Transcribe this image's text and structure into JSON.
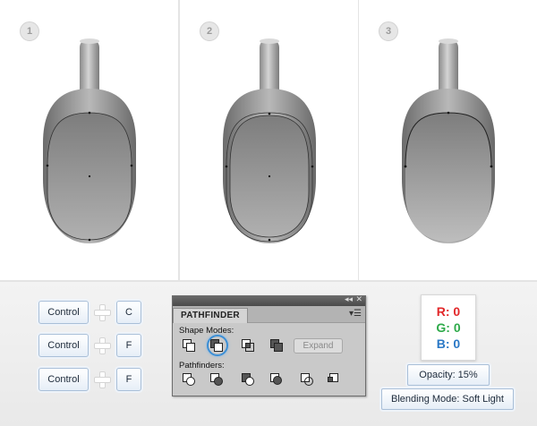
{
  "steps": [
    "1",
    "2",
    "3"
  ],
  "shortcuts": [
    {
      "modifier": "Control",
      "key": "C"
    },
    {
      "modifier": "Control",
      "key": "F"
    },
    {
      "modifier": "Control",
      "key": "F"
    }
  ],
  "pathfinder": {
    "title_bar_collapse": "◂◂",
    "title_bar_close": "✕",
    "tab": "PATHFINDER",
    "menu_icon": "menu-icon",
    "shape_modes_label": "Shape Modes:",
    "pathfinders_label": "Pathfinders:",
    "expand_label": "Expand",
    "selected_mode": "minus-front"
  },
  "color": {
    "r": "R: 0",
    "g": "G: 0",
    "b": "B: 0"
  },
  "opacity": "Opacity: 15%",
  "blending": "Blending Mode: Soft Light",
  "colors": {
    "accent": "#3c8fd6",
    "red": "#e2282a",
    "green": "#2eaa4a",
    "blue": "#2a78c6"
  }
}
